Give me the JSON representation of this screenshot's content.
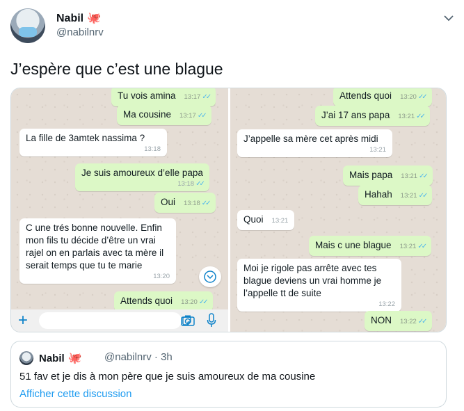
{
  "tweet": {
    "author_name": "Nabil",
    "author_handle": "@nabilnrv",
    "author_emoji": "🐙",
    "text": "J’espère que c’est une blague",
    "more_icon": "chevron-down-icon"
  },
  "chat_left": {
    "messages": [
      {
        "type": "sent",
        "text": "Tu vois amina",
        "time": "13:17"
      },
      {
        "type": "sent",
        "text": "Ma cousine",
        "time": "13:17"
      },
      {
        "type": "received",
        "text": "La fille de 3amtek nassima ?",
        "time": "13:18"
      },
      {
        "type": "sent",
        "text": "Je suis amoureux d’elle papa",
        "time": "13:18"
      },
      {
        "type": "sent",
        "text": "Oui",
        "time": "13:18"
      },
      {
        "type": "received",
        "lines": [
          "C une trés bonne nouvelle. Enfin",
          "mon fils tu décide d’être un vrai",
          "rajel on en parlais avec ta mère il",
          "serait temps que tu te marie"
        ],
        "time": "13:20"
      },
      {
        "type": "sent",
        "text": "Attends quoi",
        "time": "13:20"
      }
    ],
    "input_icons": [
      "plus-icon",
      "sticker-icon",
      "camera-icon",
      "microphone-icon",
      "scroll-down-icon"
    ]
  },
  "chat_right": {
    "messages": [
      {
        "type": "sent",
        "text": "Attends quoi",
        "time": "13:20"
      },
      {
        "type": "sent",
        "text": "J’ai 17 ans papa",
        "time": "13:21"
      },
      {
        "type": "received",
        "text": "J’appelle sa mère cet après midi",
        "time": "13:21"
      },
      {
        "type": "sent",
        "text": "Mais papa",
        "time": "13:21"
      },
      {
        "type": "sent",
        "text": "Hahah",
        "time": "13:21"
      },
      {
        "type": "received",
        "text": "Quoi",
        "time": "13:21"
      },
      {
        "type": "sent",
        "text": "Mais c une blague",
        "time": "13:21"
      },
      {
        "type": "received",
        "lines": [
          "Moi je rigole pas arrête avec tes",
          "blague deviens un vrai homme je",
          "l’appelle tt de suite"
        ],
        "time": "13:22"
      },
      {
        "type": "sent",
        "text": "NON",
        "time": "13:22"
      }
    ]
  },
  "quote": {
    "author_name": "Nabil",
    "author_emoji": "🐙",
    "author_handle": "@nabilnrv · 3h",
    "text": "51 fav et je dis à mon père que je suis amoureux de ma cousine",
    "link": "Afficher cette discussion"
  },
  "colors": {
    "sent_bubble": "#dcf8c6",
    "received_bubble": "#ffffff",
    "chat_background": "#e5ddd5",
    "read_ticks": "#4fb6ec",
    "link_blue": "#1d9bf0"
  }
}
